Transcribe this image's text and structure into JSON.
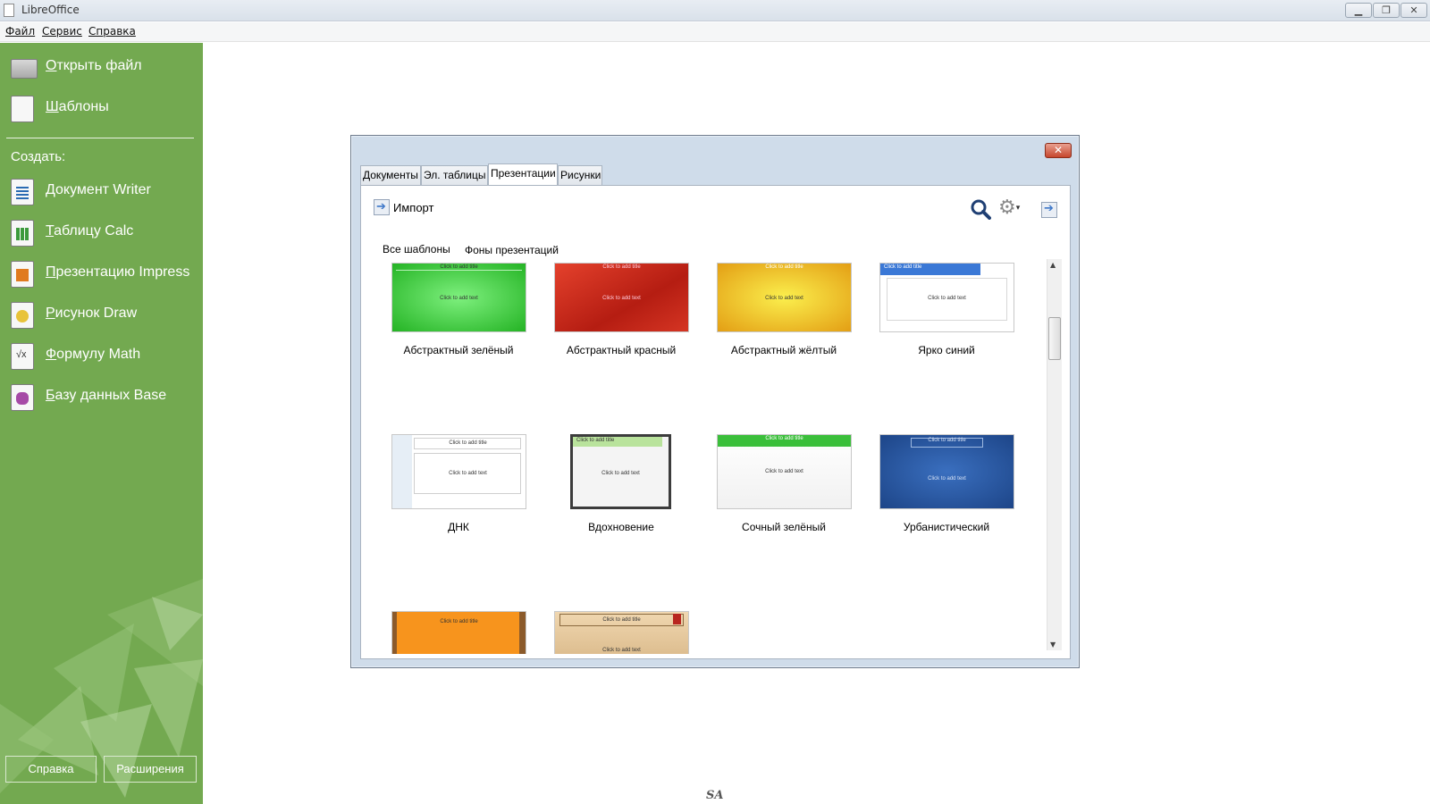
{
  "window": {
    "title": "LibreOffice"
  },
  "menu": [
    {
      "label": "Файл"
    },
    {
      "label": "Сервис"
    },
    {
      "label": "Справка"
    }
  ],
  "sidebar": {
    "top_items": [
      {
        "label": "Открыть файл",
        "icon": "open-folder-icon"
      },
      {
        "label": "Шаблоны",
        "icon": "template-document-icon"
      }
    ],
    "create_label": "Создать:",
    "create_items": [
      {
        "label": "Документ Writer",
        "icon": "writer-icon"
      },
      {
        "label": "Таблицу Calc",
        "icon": "calc-icon"
      },
      {
        "label": "Презентацию Impress",
        "icon": "impress-icon"
      },
      {
        "label": "Рисунок Draw",
        "icon": "draw-icon"
      },
      {
        "label": "Формулу Math",
        "icon": "math-icon"
      },
      {
        "label": "Базу данных Base",
        "icon": "base-icon"
      }
    ],
    "help_button": "Справка",
    "extensions_button": "Расширения",
    "background_color": "#73a950"
  },
  "dialog": {
    "tabs": [
      {
        "label": "Документы",
        "active": false
      },
      {
        "label": "Эл. таблицы",
        "active": false
      },
      {
        "label": "Презентации",
        "active": true
      },
      {
        "label": "Рисунки",
        "active": false
      }
    ],
    "import_label": "Импорт",
    "subtabs": [
      "Все шаблоны",
      "Фоны презентаций"
    ],
    "thumbnail_title_text": "Click to add title",
    "thumbnail_body_text": "Click to add text",
    "templates": [
      {
        "name": "Абстрактный зелёный",
        "colors": [
          "#2fbf2f",
          "#5fe35f"
        ]
      },
      {
        "name": "Абстрактный красный",
        "colors": [
          "#c8281a",
          "#e24a35"
        ]
      },
      {
        "name": "Абстрактный жёлтый",
        "colors": [
          "#e4a218",
          "#f7df3a"
        ]
      },
      {
        "name": "Ярко синий",
        "colors": [
          "#ffffff",
          "#3a78d6"
        ]
      },
      {
        "name": "ДНК",
        "colors": [
          "#ffffff",
          "#dfe9f2"
        ]
      },
      {
        "name": "Вдохновение",
        "colors": [
          "#f2f2f2",
          "#3c3c3c"
        ]
      },
      {
        "name": "Сочный зелёный",
        "colors": [
          "#ffffff",
          "#3bbf3b"
        ]
      },
      {
        "name": "Урбанистический",
        "colors": [
          "#2a5aa6",
          "#1c3f7a"
        ]
      },
      {
        "name": "",
        "colors": [
          "#f28a16",
          "#8b5a2b"
        ]
      },
      {
        "name": "",
        "colors": [
          "#e8cda6",
          "#b8261f"
        ]
      }
    ]
  },
  "footer_logo": "SA"
}
